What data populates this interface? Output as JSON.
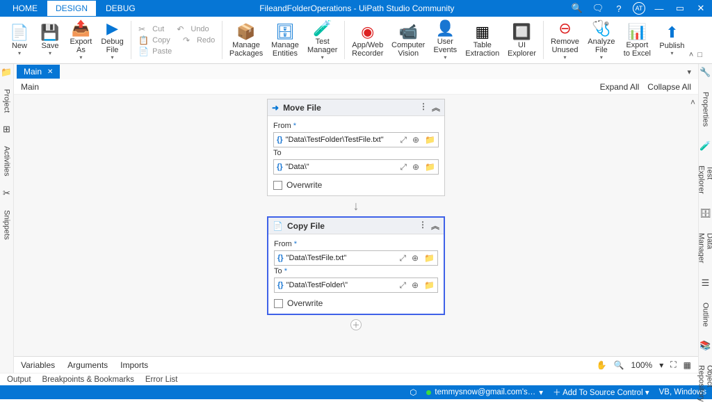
{
  "title": "FileandFolderOperations - UiPath Studio Community",
  "menuTabs": {
    "home": "HOME",
    "design": "DESIGN",
    "debug": "DEBUG"
  },
  "titleRight": {
    "avatar": "AT"
  },
  "ribbon": {
    "new": "New",
    "save": "Save",
    "exportAs": "Export\nAs",
    "debugFile": "Debug\nFile",
    "cut": "Cut",
    "copy": "Copy",
    "paste": "Paste",
    "undo": "Undo",
    "redo": "Redo",
    "managePackages": "Manage\nPackages",
    "manageEntities": "Manage\nEntities",
    "testManager": "Test\nManager",
    "appWebRecorder": "App/Web\nRecorder",
    "computerVision": "Computer\nVision",
    "userEvents": "User\nEvents",
    "tableExtraction": "Table\nExtraction",
    "uiExplorer": "UI\nExplorer",
    "removeUnused": "Remove\nUnused",
    "analyzeFile": "Analyze\nFile",
    "exportToExcel": "Export\nto Excel",
    "publish": "Publish"
  },
  "sideLeft": {
    "project": "Project",
    "activities": "Activities",
    "snippets": "Snippets"
  },
  "sideRight": {
    "properties": "Properties",
    "testExplorer": "Test Explorer",
    "dataManager": "Data Manager",
    "outline": "Outline",
    "objectRepo": "Object Repository"
  },
  "docTab": {
    "name": "Main"
  },
  "breadcrumb": {
    "main": "Main",
    "expandAll": "Expand All",
    "collapseAll": "Collapse All"
  },
  "activities": {
    "moveFile": {
      "title": "Move File",
      "fromLabel": "From",
      "fromVal": "\"Data\\TestFolder\\TestFile.txt\"",
      "toLabel": "To",
      "toVal": "\"Data\\\"",
      "overwrite": "Overwrite"
    },
    "copyFile": {
      "title": "Copy File",
      "fromLabel": "From",
      "fromVal": "\"Data\\TestFile.txt\"",
      "toLabel": "To",
      "toVal": "\"Data\\TestFolder\\\"",
      "overwrite": "Overwrite"
    }
  },
  "bottomPanel": {
    "variables": "Variables",
    "arguments": "Arguments",
    "imports": "Imports",
    "zoom": "100%"
  },
  "panelTabs": {
    "output": "Output",
    "breakpoints": "Breakpoints & Bookmarks",
    "errorList": "Error List"
  },
  "statusBar": {
    "email": "temmysnow@gmail.com's…",
    "addSource": "Add To Source Control",
    "lang": "VB, Windows"
  },
  "req": "*"
}
